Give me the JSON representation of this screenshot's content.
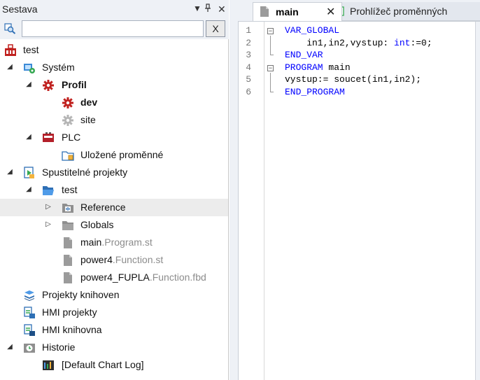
{
  "left_panel": {
    "title": "Sestava",
    "controls": {
      "menu": "▼",
      "pin": "ᵖ",
      "close": "✕"
    },
    "search": {
      "value": "",
      "placeholder": "",
      "clear_label": "X"
    },
    "tree": [
      {
        "label": "test",
        "icon": "project-root-icon"
      },
      {
        "label": "Systém",
        "icon": "system-icon"
      },
      {
        "label": "Profil",
        "icon": "gear-red-icon"
      },
      {
        "label": "dev",
        "icon": "gear-red-icon"
      },
      {
        "label": "site",
        "icon": "gear-grey-icon"
      },
      {
        "label": "PLC",
        "icon": "plc-icon"
      },
      {
        "label": "Uložené proměnné",
        "icon": "saved-variables-icon"
      },
      {
        "label": "Spustitelné projekty",
        "icon": "executable-projects-icon"
      },
      {
        "label": "test",
        "icon": "folder-open-icon"
      },
      {
        "label": "Reference",
        "icon": "reference-folder-icon"
      },
      {
        "label": "Globals",
        "icon": "folder-icon"
      },
      {
        "label": "main",
        "ext": ".Program.st",
        "icon": "file-icon"
      },
      {
        "label": "power4",
        "ext": ".Function.st",
        "icon": "file-icon"
      },
      {
        "label": "power4_FUPLA",
        "ext": ".Function.fbd",
        "icon": "file-icon"
      },
      {
        "label": "Projekty knihoven",
        "icon": "library-projects-icon"
      },
      {
        "label": "HMI projekty",
        "icon": "hmi-icon"
      },
      {
        "label": "HMI knihovna",
        "icon": "hmi-library-icon"
      },
      {
        "label": "Historie",
        "icon": "history-icon"
      },
      {
        "label": "[Default Chart Log]",
        "icon": "chart-log-icon"
      }
    ]
  },
  "tabs": [
    {
      "label": "main",
      "icon": "file-icon",
      "active": true,
      "close": "✕"
    },
    {
      "label": "Prohlížeč proměnných",
      "icon": "variable-viewer-icon",
      "active": false
    }
  ],
  "editor": {
    "line_numbers": [
      "1",
      "2",
      "3",
      "4",
      "5",
      "6"
    ],
    "lines": [
      {
        "kw": "VAR_GLOBAL",
        "text": ""
      },
      {
        "text": "    in1,in2,vystup: ",
        "kw": "int",
        "rest": ":=0;"
      },
      {
        "kw": "END_VAR",
        "text": ""
      },
      {
        "kw": "PROGRAM",
        "text": " main"
      },
      {
        "text": "vystup:= soucet(in1,in2);"
      },
      {
        "kw": "END_PROGRAM",
        "text": ""
      }
    ]
  },
  "colors": {
    "panel_bg": "#eef1f6",
    "keyword": "#0000ff",
    "selection": "#ececec",
    "accent_red": "#c0211f"
  }
}
